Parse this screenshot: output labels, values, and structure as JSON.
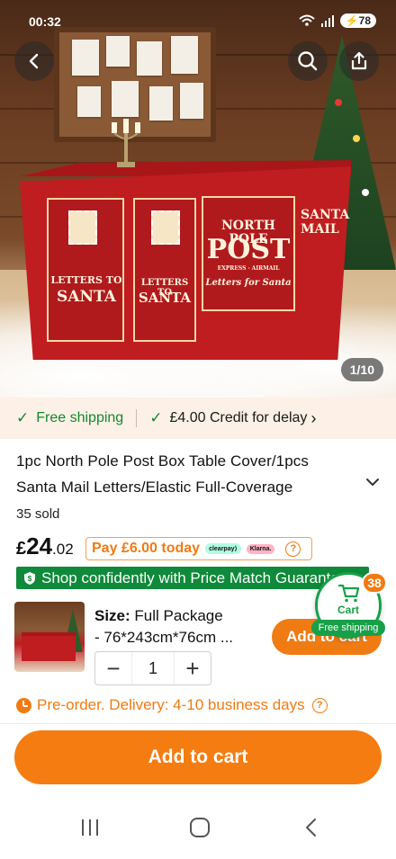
{
  "status_bar": {
    "time": "00:32",
    "battery": "78"
  },
  "gallery": {
    "counter": "1/10",
    "artwork": {
      "table_text_main": "NORTH POLE",
      "table_text_post": "POST",
      "table_text_express": "EXPRESS · AIRMAIL",
      "table_text_script": "Letters for Santa",
      "panel_left_1": "LETTERS TO",
      "panel_left_2": "SANTA",
      "panel_mid_1": "LETTERS TO",
      "panel_mid_2": "SANTA",
      "panel_right_1": "SANTA",
      "panel_right_2": "MAIL"
    }
  },
  "shipping_strip": {
    "free_shipping": "Free shipping",
    "credit": "£4.00 Credit for delay",
    "credit_chevron": "›"
  },
  "product": {
    "title_line1": "1pc North Pole Post Box Table Cover/1pcs",
    "title_line2": "Santa Mail Letters/Elastic Full-Coverage",
    "sold": "35 sold",
    "price_currency": "£",
    "price_whole": "24",
    "price_decimal": ".02",
    "pay_today": "Pay £6.00 today",
    "clearpay": "clearpay⟩",
    "klarna": "Klarna.",
    "price_match": "Shop confidently with Price Match Guarantee"
  },
  "sku": {
    "size_label": "Size:",
    "size_value": "Full Package",
    "size_detail": "- 76*243cm*76cm ...",
    "quantity": "1",
    "minus": "−",
    "plus": "+",
    "add_to_cart_small": "Add to cart"
  },
  "cart_float": {
    "label": "Cart",
    "badge": "38",
    "free_shipping": "Free shipping"
  },
  "delivery": {
    "text": "Pre-order. Delivery: 4-10 business days"
  },
  "cta": {
    "add_to_cart": "Add to cart"
  },
  "colors": {
    "accent": "#f57c10",
    "green": "#128a2e",
    "brand_green_banner": "#0f8a3a"
  }
}
